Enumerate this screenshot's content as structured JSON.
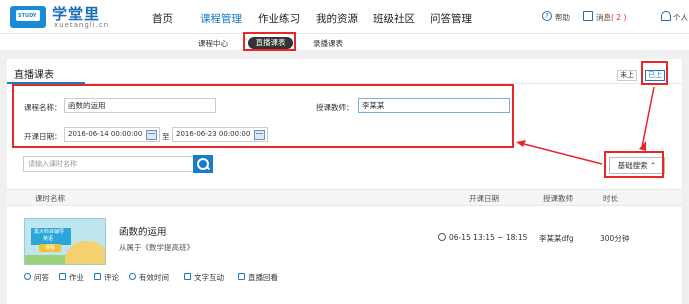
{
  "header": {
    "logo_badge": "STUDY",
    "logo_title": "学堂里",
    "logo_sub": "xuetangli.cn",
    "nav": [
      "首页",
      "课程管理",
      "作业练习",
      "我的资源",
      "班级社区",
      "问答管理"
    ],
    "help": "帮助",
    "messages": "消息",
    "message_count": "( 2 )",
    "personal": "个人"
  },
  "subnav": {
    "items": [
      "课程中心",
      "直播课表",
      "录播课表"
    ],
    "active_index": 1
  },
  "panel": {
    "title": "直播课表",
    "toggle_before": "未上",
    "toggle_after": "已上",
    "course_name_label": "课程名称：",
    "course_name_value": "函数的运用",
    "teacher_label": "授课教师：",
    "teacher_value": "李某某",
    "date_label": "开课日期：",
    "date_from": "2016-06-14 00:00:00",
    "date_sep": "至",
    "date_to": "2016-06-23 00:00:00",
    "search_placeholder": "请输入课时名称",
    "advanced_search": "基础搜索 ⌃"
  },
  "table": {
    "columns": [
      "课时名称",
      "开课日期",
      "授课教师",
      "时长"
    ],
    "rows": [
      {
        "thumb_line1": "黑大科目辅导",
        "thumb_line2": "英语",
        "thumb_badge": "课程",
        "title": "函数的运用",
        "from": "从属于《数学提高班》",
        "time": "06-15 13:15 ~ 18:15",
        "teacher": "李某某dfg",
        "duration": "300分钟",
        "actions": [
          "问答",
          "作业",
          "评论",
          "有效时间",
          "文字互动",
          "直播回看"
        ]
      }
    ]
  },
  "colors": {
    "accent": "#1a7bc9",
    "annotation": "#e8262c"
  }
}
